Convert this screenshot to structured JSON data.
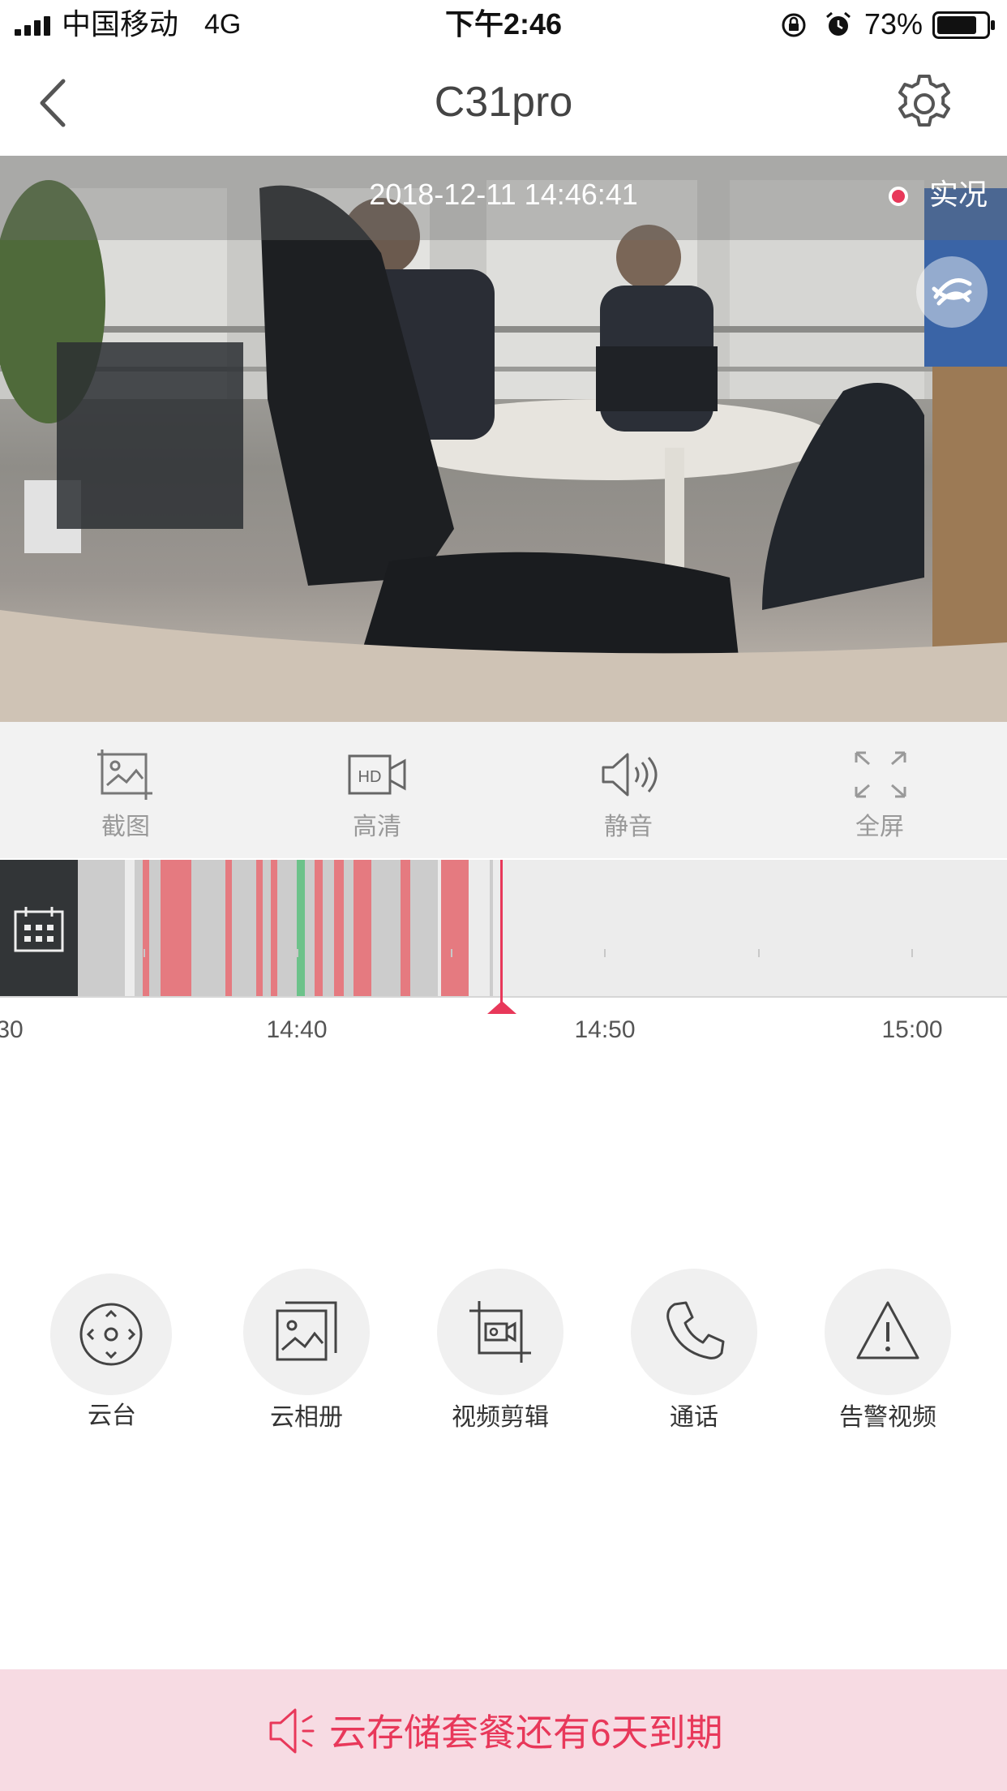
{
  "status_bar": {
    "carrier": "中国移动",
    "network": "4G",
    "time": "下午2:46",
    "battery_percent": "73%",
    "icons": [
      "signal-icon",
      "rotation-lock-icon",
      "alarm-icon",
      "battery-icon"
    ]
  },
  "nav": {
    "title": "C31pro",
    "icons": [
      "back-icon",
      "gear-icon"
    ]
  },
  "video": {
    "timestamp": "2018-12-11 14:46:41",
    "live_label": "实况",
    "live_color": "#e8385a"
  },
  "toolbar": {
    "items": [
      {
        "label": "截图",
        "icon": "screenshot-icon"
      },
      {
        "label": "高清",
        "icon": "hd-icon"
      },
      {
        "label": "静音",
        "icon": "speaker-icon"
      },
      {
        "label": "全屏",
        "icon": "fullscreen-icon"
      }
    ]
  },
  "timeline": {
    "tick_labels": [
      "30",
      "14:40",
      "14:50",
      "15:00"
    ],
    "legend_colors": {
      "recording": "#cccccc",
      "alarm": "#e57a80",
      "motion": "#6cc28a"
    },
    "playhead_color": "#e8385a"
  },
  "actions": [
    {
      "label": "云台",
      "icon": "pan-tilt-icon"
    },
    {
      "label": "云相册",
      "icon": "cloud-album-icon"
    },
    {
      "label": "视频剪辑",
      "icon": "video-clip-icon"
    },
    {
      "label": "通话",
      "icon": "phone-icon"
    },
    {
      "label": "告警视频",
      "icon": "warning-icon"
    }
  ],
  "banner": {
    "text": "云存储套餐还有6天到期",
    "color": "#e8385a",
    "icon": "speaker-notice-icon"
  }
}
